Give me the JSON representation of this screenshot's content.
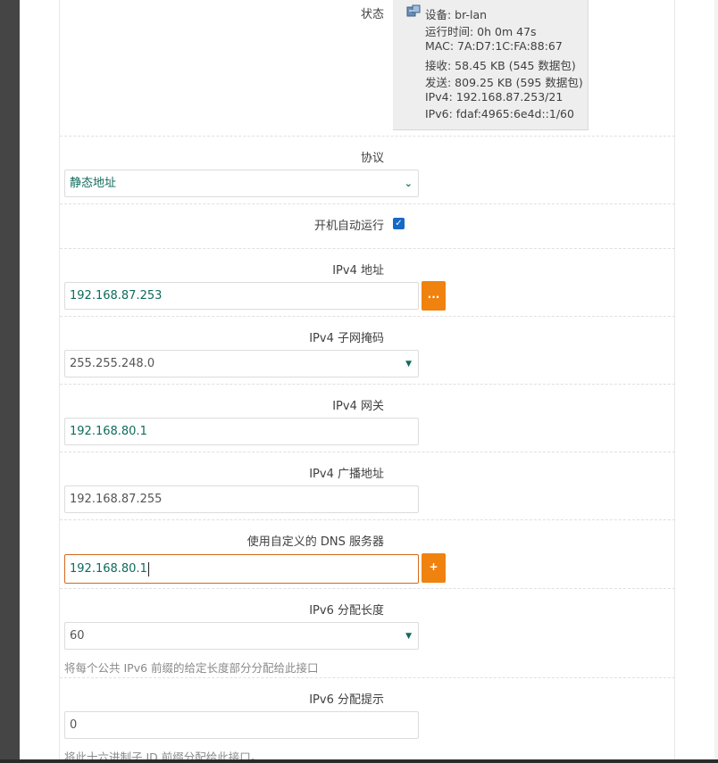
{
  "status": {
    "label": "状态",
    "lines": [
      "设备: br-lan",
      "运行时间: 0h 0m 47s",
      "MAC: 7A:D7:1C:FA:88:67",
      "接收: 58.45 KB (545 数据包)",
      "发送: 809.25 KB (595 数据包)",
      "IPv4: 192.168.87.253/21",
      "IPv6: fdaf:4965:6e4d::1/60"
    ]
  },
  "protocol": {
    "label": "协议",
    "value": "静态地址"
  },
  "autostart": {
    "label": "开机自动运行",
    "checked": true
  },
  "ipv4_addr": {
    "label": "IPv4 地址",
    "value": "192.168.87.253",
    "button": "..."
  },
  "ipv4_mask": {
    "label": "IPv4 子网掩码",
    "value": "255.255.248.0"
  },
  "ipv4_gw": {
    "label": "IPv4 网关",
    "value": "192.168.80.1"
  },
  "ipv4_bcast": {
    "label": "IPv4 广播地址",
    "value": "192.168.87.255"
  },
  "dns": {
    "label": "使用自定义的 DNS 服务器",
    "value": "192.168.80.1",
    "button": "+"
  },
  "ip6_len": {
    "label": "IPv6 分配长度",
    "value": "60",
    "hint": "将每个公共 IPv6 前缀的给定长度部分分配给此接口"
  },
  "ip6_hint": {
    "label": "IPv6 分配提示",
    "value": "0",
    "hint": "将此十六进制子 ID 前缀分配给此接口。"
  },
  "colors": {
    "accent": "#f0820f",
    "value_text": "#0f6b5c",
    "checkbox": "#1769c7"
  }
}
